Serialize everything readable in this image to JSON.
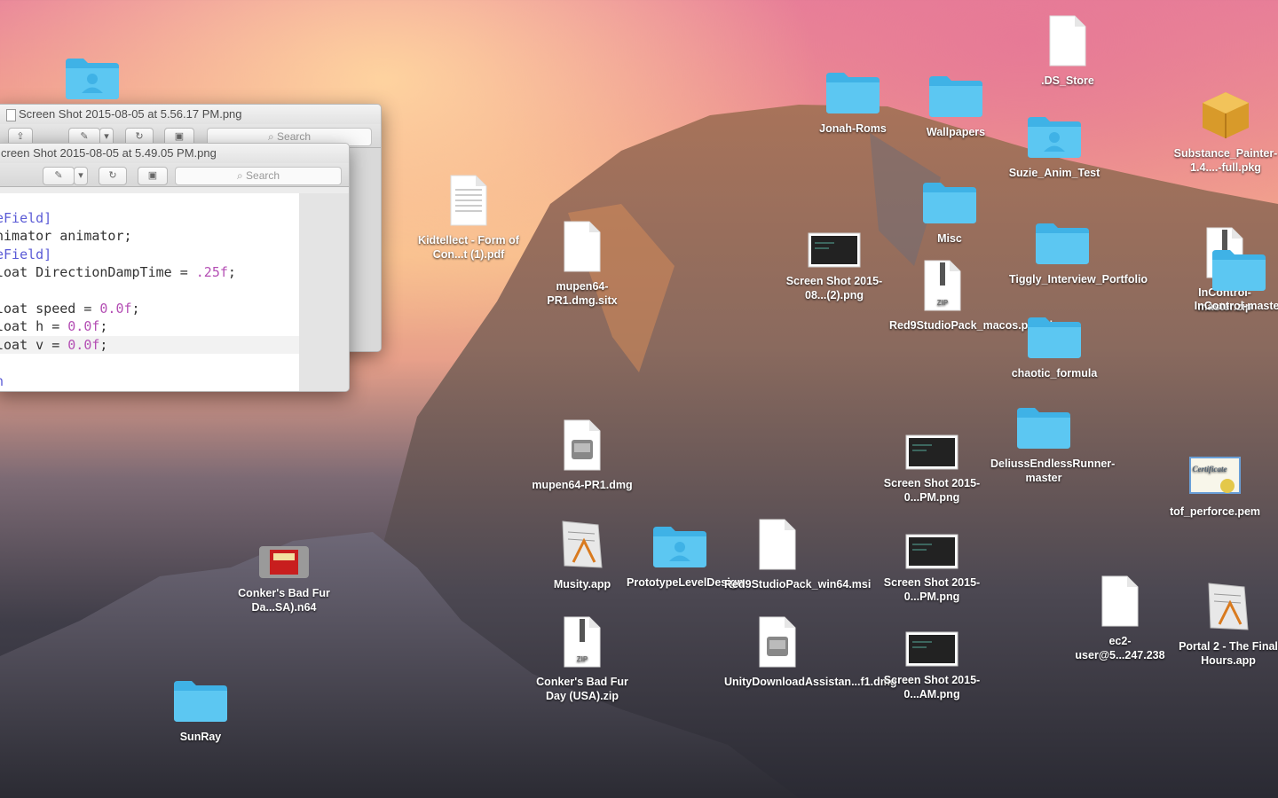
{
  "windows": {
    "back": {
      "title": "Screen Shot 2015-08-05 at 5.56.17 PM.png",
      "search_placeholder": "Search"
    },
    "front": {
      "title": "creen Shot 2015-08-05 at 5.49.05 PM.png",
      "search_placeholder": "Search",
      "code_lines": [
        {
          "a": "eField]",
          "b": "",
          "c": ""
        },
        {
          "a": "nimator animator;",
          "b": "",
          "c": ""
        },
        {
          "a": "eField]",
          "b": "",
          "c": ""
        },
        {
          "a": "loat DirectionDampTime = ",
          "b": ".25f",
          "c": ";"
        },
        {
          "a": "",
          "b": "",
          "c": ""
        },
        {
          "a": "loat speed = ",
          "b": "0.0f",
          "c": ";"
        },
        {
          "a": "loat h = ",
          "b": "0.0f",
          "c": ";"
        },
        {
          "a": "loat v = ",
          "b": "0.0f",
          "c": ";"
        },
        {
          "a": "",
          "b": "",
          "c": ""
        },
        {
          "a": "n",
          "b": "",
          "c": ""
        }
      ]
    }
  },
  "desktop_icons": [
    {
      "label": ".DS_Store",
      "kind": "document-icon"
    },
    {
      "label": "Jonah-Roms",
      "kind": "folder-icon"
    },
    {
      "label": "Wallpapers",
      "kind": "folder-icon"
    },
    {
      "label": "Suzie_Anim_Test",
      "kind": "user-folder-icon"
    },
    {
      "label": "Substance_Painter-1.4....-full.pkg",
      "kind": "package-icon"
    },
    {
      "label": "Kidtellect - Form of Con...t (1).pdf",
      "kind": "pdf-icon"
    },
    {
      "label": "mupen64-PR1.dmg.sitx",
      "kind": "document-icon"
    },
    {
      "label": "Screen Shot 2015-08...(2).png",
      "kind": "screenshot-icon"
    },
    {
      "label": "Misc",
      "kind": "folder-icon"
    },
    {
      "label": "Tiggly_Interview_Portfolio",
      "kind": "folder-icon"
    },
    {
      "label": "InControl-master.zip",
      "kind": "zip-icon"
    },
    {
      "label": "InControl-master",
      "kind": "folder-icon"
    },
    {
      "label": "Red9StudioPack_macos.pkg.zip",
      "kind": "zip-icon"
    },
    {
      "label": "chaotic_formula",
      "kind": "folder-icon"
    },
    {
      "label": "DeliussEndlessRunner-master",
      "kind": "folder-icon"
    },
    {
      "label": "mupen64-PR1.dmg",
      "kind": "disk-image-icon"
    },
    {
      "label": "Screen Shot 2015-0...PM.png",
      "kind": "screenshot-icon"
    },
    {
      "label": "tof_perforce.pem",
      "kind": "certificate-icon"
    },
    {
      "label": "Conker's Bad Fur Da...SA).n64",
      "kind": "cartridge-icon"
    },
    {
      "label": "Musity.app",
      "kind": "app-icon"
    },
    {
      "label": "PrototypeLevelDesign",
      "kind": "user-folder-icon"
    },
    {
      "label": "Red9StudioPack_win64.msi",
      "kind": "document-icon"
    },
    {
      "label": "Screen Shot 2015-0...PM.png",
      "kind": "screenshot-icon"
    },
    {
      "label": "ec2-user@5...247.238",
      "kind": "document-icon"
    },
    {
      "label": "Portal 2 - The Final Hours.app",
      "kind": "app-icon"
    },
    {
      "label": "Conker's Bad Fur Day (USA).zip",
      "kind": "zip-icon"
    },
    {
      "label": "UnityDownloadAssistan...f1.dmg",
      "kind": "disk-image-icon"
    },
    {
      "label": "Screen Shot 2015-0...AM.png",
      "kind": "screenshot-icon"
    },
    {
      "label": "SunRay",
      "kind": "folder-icon"
    },
    {
      "label": "",
      "kind": "user-folder-icon"
    }
  ],
  "colors": {
    "folder": "#5cc7f2",
    "folder_dark": "#3fb2e6",
    "keyword": "#5b5bd6",
    "number": "#b44fb4"
  }
}
